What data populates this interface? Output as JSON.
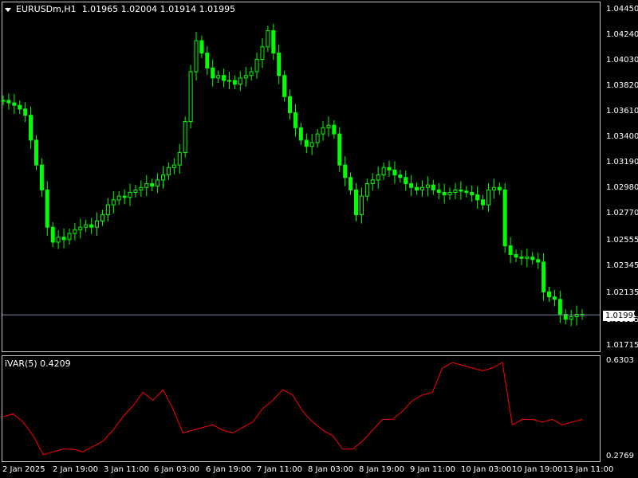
{
  "header": {
    "symbol": "EURUSDm,H1",
    "ohlc": "1.01965 1.02004 1.01914 1.01995"
  },
  "subwindow": {
    "indicator_label": "iVAR(5) 0.4209"
  },
  "price_axis": [
    "1.04450",
    "1.04240",
    "1.04030",
    "1.03820",
    "1.03610",
    "1.03400",
    "1.03190",
    "1.02980",
    "1.02770",
    "1.02555",
    "1.02345",
    "1.02135",
    "1.01925",
    "1.01715"
  ],
  "current_price": "1.01995",
  "indicator_axis": [
    "0.6303",
    "0.2769"
  ],
  "time_axis": [
    "2 Jan 2025",
    "2 Jan 19:00",
    "3 Jan 11:00",
    "6 Jan 03:00",
    "6 Jan 19:00",
    "7 Jan 11:00",
    "8 Jan 03:00",
    "8 Jan 19:00",
    "9 Jan 11:00",
    "10 Jan 03:00",
    "10 Jan 19:00",
    "13 Jan 11:00"
  ],
  "colors": {
    "candles": "#00ff00",
    "indicator": "#ff0000",
    "price_line": "#778899",
    "frame": "#c8c8c8",
    "background": "#000000"
  },
  "chart_data": [
    {
      "type": "line",
      "title": "EURUSDm,H1",
      "series": [
        {
          "name": "EURUSDm,H1",
          "values": [
            1.0372,
            1.037,
            1.0368,
            1.0365,
            1.036,
            1.034,
            1.032,
            1.03,
            1.027,
            1.0258,
            1.0262,
            1.026,
            1.0265,
            1.0268,
            1.027,
            1.0272,
            1.027,
            1.0275,
            1.028,
            1.0288,
            1.0292,
            1.0295,
            1.0294,
            1.0298,
            1.03,
            1.0302,
            1.0305,
            1.0303,
            1.0308,
            1.0312,
            1.0318,
            1.032,
            1.033,
            1.0355,
            1.0395,
            1.042,
            1.041,
            1.0398,
            1.039,
            1.0392,
            1.0388,
            1.0388,
            1.0385,
            1.039,
            1.0392,
            1.0395,
            1.0405,
            1.0415,
            1.0428,
            1.041,
            1.0392,
            1.0375,
            1.0362,
            1.035,
            1.034,
            1.0335,
            1.0338,
            1.0345,
            1.035,
            1.0352,
            1.0345,
            1.032,
            1.031,
            1.03,
            1.028,
            1.0295,
            1.0305,
            1.0308,
            1.0312,
            1.0318,
            1.0316,
            1.0312,
            1.031,
            1.0305,
            1.0302,
            1.03,
            1.0302,
            1.0304,
            1.03,
            1.0298,
            1.0296,
            1.0298,
            1.03,
            1.0299,
            1.0298,
            1.0296,
            1.0292,
            1.0288,
            1.03,
            1.0302,
            1.03,
            1.0255,
            1.0248,
            1.0246,
            1.0245,
            1.0246,
            1.0244,
            1.0242,
            1.0218,
            1.0214,
            1.0212,
            1.02,
            1.0196,
            1.0198,
            1.02,
            1.01995
          ]
        }
      ],
      "ylim": [
        1.01715,
        1.0445
      ]
    },
    {
      "type": "line",
      "title": "iVAR(5)",
      "series": [
        {
          "name": "iVAR(5)",
          "values": [
            0.43,
            0.44,
            0.41,
            0.36,
            0.29,
            0.3,
            0.31,
            0.31,
            0.3,
            0.32,
            0.34,
            0.38,
            0.43,
            0.47,
            0.52,
            0.49,
            0.53,
            0.46,
            0.37,
            0.38,
            0.39,
            0.4,
            0.38,
            0.37,
            0.39,
            0.41,
            0.46,
            0.49,
            0.53,
            0.51,
            0.45,
            0.41,
            0.38,
            0.36,
            0.31,
            0.31,
            0.34,
            0.38,
            0.42,
            0.42,
            0.45,
            0.49,
            0.51,
            0.52,
            0.61,
            0.63,
            0.62,
            0.61,
            0.6,
            0.61,
            0.63,
            0.4,
            0.42,
            0.42,
            0.41,
            0.42,
            0.4,
            0.41,
            0.42
          ]
        }
      ],
      "ylim": [
        0.2769,
        0.6303
      ]
    }
  ]
}
